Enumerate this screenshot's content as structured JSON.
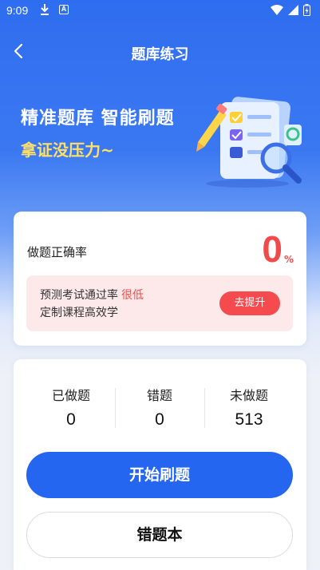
{
  "status_bar": {
    "time": "9:09",
    "icons": [
      "download-icon",
      "a-badge-icon",
      "wifi-icon",
      "signal-icon",
      "battery-icon"
    ]
  },
  "nav": {
    "title": "题库练习",
    "back_icon": "chevron-left-icon"
  },
  "hero": {
    "title": "精准题库 智能刷题",
    "subtitle": "拿证没压力~",
    "illustration": "quiz-document-illustration"
  },
  "rate_card": {
    "label": "做题正确率",
    "value": "0",
    "unit": "%",
    "tip": {
      "prefix": "预测考试通过率",
      "level": "很低",
      "line2": "定制课程高效学"
    },
    "button": "去提升"
  },
  "stats": {
    "done_label": "已做题",
    "done_value": "0",
    "wrong_label": "错题",
    "wrong_value": "0",
    "undone_label": "未做题",
    "undone_value": "513"
  },
  "actions": {
    "start": "开始刷题",
    "wrong_book": "错题本"
  },
  "colors": {
    "primary": "#2466f0",
    "danger": "#f04b4b",
    "highlight": "#ffe066"
  }
}
